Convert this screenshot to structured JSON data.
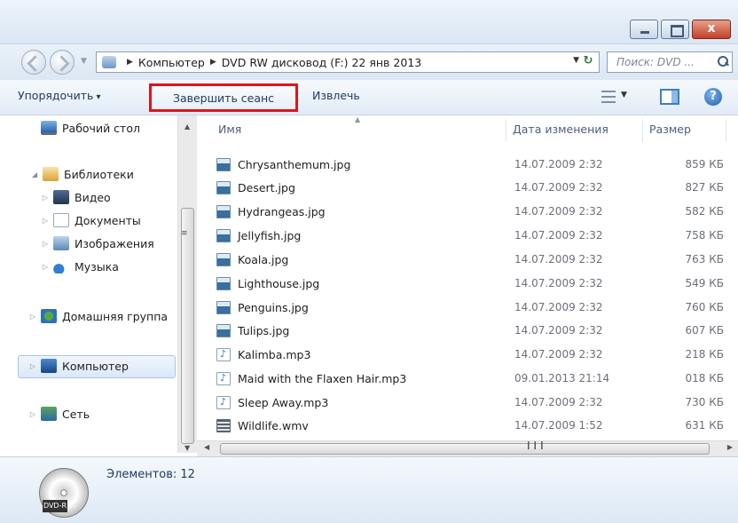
{
  "window": {
    "minimize": "",
    "maximize": "",
    "close": "x"
  },
  "address": {
    "crumbs": [
      "Компьютер",
      "DVD RW дисковод (F:) 22 янв 2013"
    ],
    "search_placeholder": "Поиск: DVD ..."
  },
  "toolbar": {
    "organize": "Упорядочить",
    "finish_session": "Завершить сеанс",
    "eject": "Извлечь",
    "help": "?"
  },
  "nav": {
    "desktop": "Рабочий стол",
    "libraries": "Библиотеки",
    "video": "Видео",
    "documents": "Документы",
    "images": "Изображения",
    "music": "Музыка",
    "homegroup": "Домашняя группа",
    "computer": "Компьютер",
    "network": "Сеть"
  },
  "columns": {
    "name": "Имя",
    "date": "Дата изменения",
    "size": "Размер"
  },
  "files": [
    {
      "name": "Chrysanthemum.jpg",
      "date": "14.07.2009 2:32",
      "size": "859 КБ",
      "type": "jpg"
    },
    {
      "name": "Desert.jpg",
      "date": "14.07.2009 2:32",
      "size": "827 КБ",
      "type": "jpg"
    },
    {
      "name": "Hydrangeas.jpg",
      "date": "14.07.2009 2:32",
      "size": "582 КБ",
      "type": "jpg"
    },
    {
      "name": "Jellyfish.jpg",
      "date": "14.07.2009 2:32",
      "size": "758 КБ",
      "type": "jpg"
    },
    {
      "name": "Koala.jpg",
      "date": "14.07.2009 2:32",
      "size": "763 КБ",
      "type": "jpg"
    },
    {
      "name": "Lighthouse.jpg",
      "date": "14.07.2009 2:32",
      "size": "549 КБ",
      "type": "jpg"
    },
    {
      "name": "Penguins.jpg",
      "date": "14.07.2009 2:32",
      "size": "760 КБ",
      "type": "jpg"
    },
    {
      "name": "Tulips.jpg",
      "date": "14.07.2009 2:32",
      "size": "607 КБ",
      "type": "jpg"
    },
    {
      "name": "Kalimba.mp3",
      "date": "14.07.2009 2:32",
      "size": "218 КБ",
      "type": "mp3"
    },
    {
      "name": "Maid with the Flaxen Hair.mp3",
      "date": "09.01.2013 21:14",
      "size": "018 КБ",
      "type": "mp3"
    },
    {
      "name": "Sleep Away.mp3",
      "date": "14.07.2009 2:32",
      "size": "730 КБ",
      "type": "mp3"
    },
    {
      "name": "Wildlife.wmv",
      "date": "14.07.2009 1:52",
      "size": "631 КБ",
      "type": "wmv"
    }
  ],
  "details": {
    "count": "Элементов: 12",
    "disc_label": "DVD-R"
  },
  "colors": {
    "highlight_border": "#e0141c",
    "accent": "#1e3a5f"
  }
}
